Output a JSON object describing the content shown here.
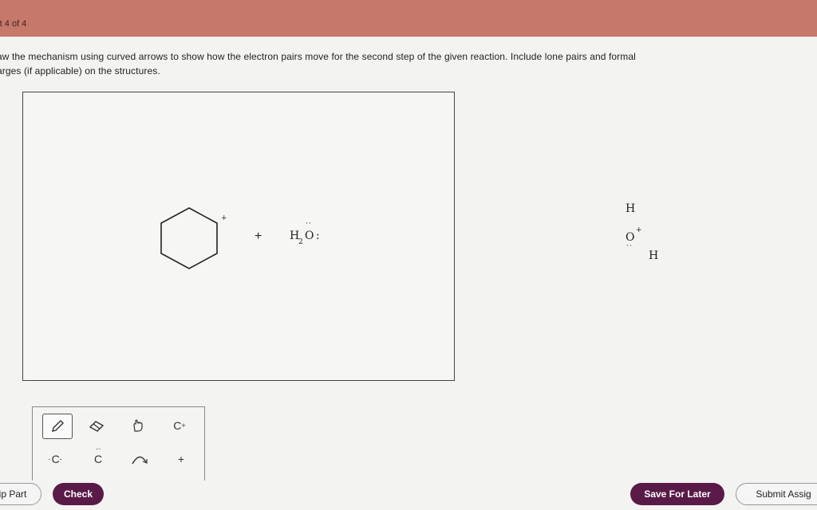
{
  "header": {
    "part_label": "rt 4 of 4"
  },
  "instructions": {
    "line1": "aw the mechanism using curved arrows to show how the electron pairs move for the second step of the given reaction. Include lone pairs and formal",
    "line2": "arges (if applicable) on the structures."
  },
  "canvas": {
    "reactant_charge": "+",
    "plus_sign": "+",
    "water_h": "H",
    "water_sub": "2",
    "water_o": "O",
    "lone_pairs": ":",
    "product_h_top": "H",
    "product_o": "O",
    "product_charge": "+",
    "product_h_right": "H"
  },
  "toolbar": {
    "carbocation_label": "C",
    "carbocation_sup": "+",
    "carbanion_label": "C",
    "carbanion_sup": "-",
    "lonepair_label": "C",
    "add_label": "+"
  },
  "buttons": {
    "skip": "ip Part",
    "check": "Check",
    "save": "Save For Later",
    "submit": "Submit Assig"
  }
}
